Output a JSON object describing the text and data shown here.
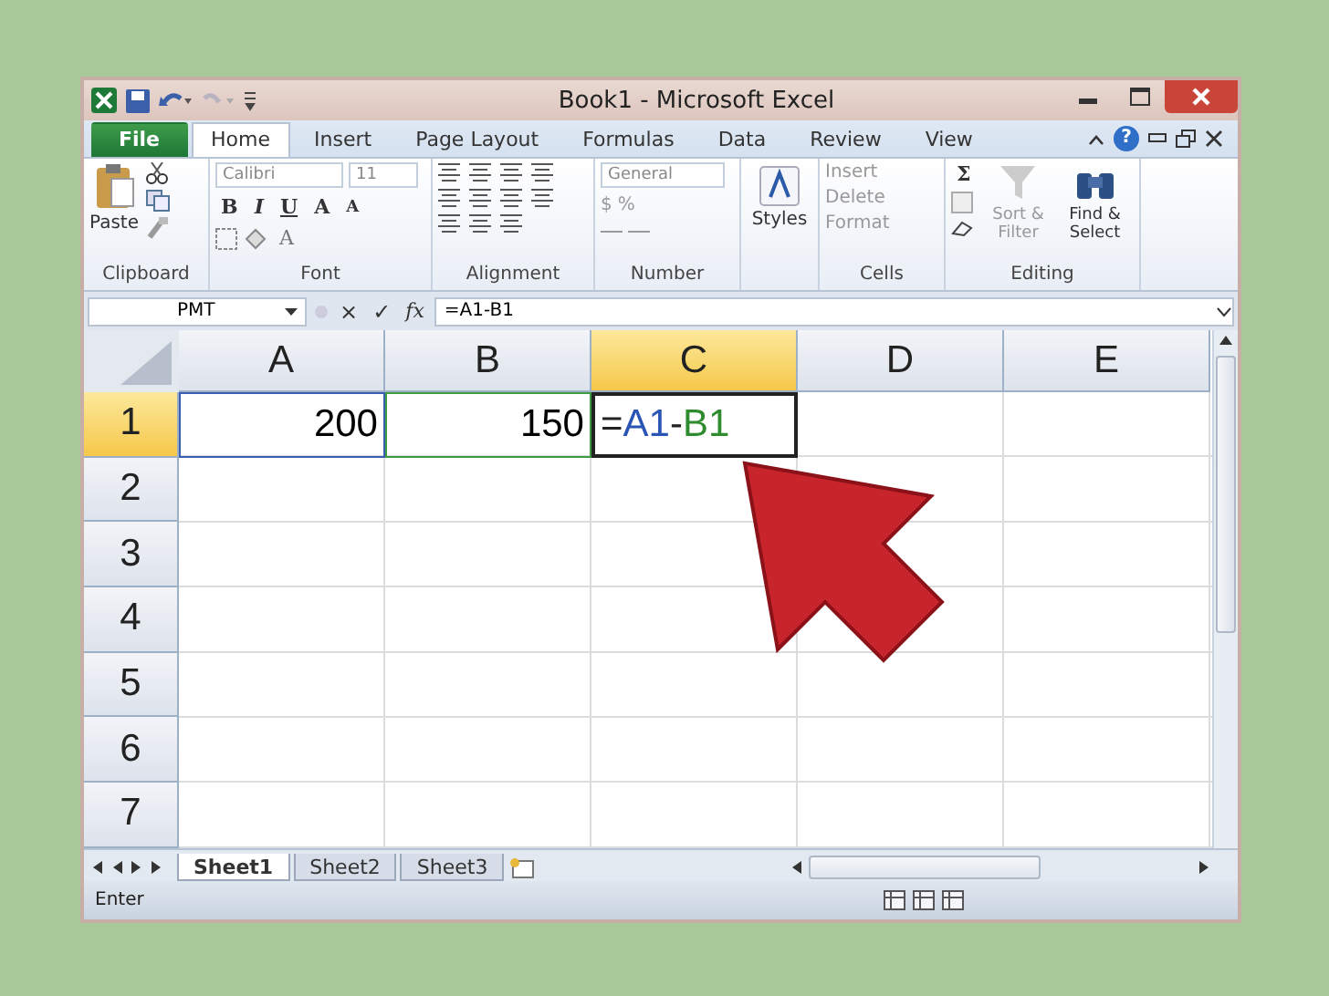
{
  "window": {
    "title": "Book1 - Microsoft Excel",
    "help": "?"
  },
  "ribbon_tabs": [
    {
      "label": "File",
      "kind": "file",
      "selected": false
    },
    {
      "label": "Home",
      "kind": "tab",
      "selected": true
    },
    {
      "label": "Insert",
      "kind": "tab",
      "selected": false
    },
    {
      "label": "Page Layout",
      "kind": "tab",
      "selected": false
    },
    {
      "label": "Formulas",
      "kind": "tab",
      "selected": false
    },
    {
      "label": "Data",
      "kind": "tab",
      "selected": false
    },
    {
      "label": "Review",
      "kind": "tab",
      "selected": false
    },
    {
      "label": "View",
      "kind": "tab",
      "selected": false
    }
  ],
  "ribbon": {
    "clipboard": {
      "paste": "Paste",
      "label": "Clipboard"
    },
    "font": {
      "name": "Calibri",
      "size": "11",
      "styles": [
        "B",
        "I",
        "U"
      ],
      "grow": "A",
      "shrink": "A",
      "font_color_button": "A",
      "label": "Font"
    },
    "alignment": {
      "label": "Alignment"
    },
    "number": {
      "format": "General",
      "currency": "$",
      "percent": "%",
      "label": "Number"
    },
    "styles": {
      "button": "Styles"
    },
    "cells": {
      "items": [
        "Insert",
        "Delete",
        "Format"
      ],
      "label": "Cells"
    },
    "editing": {
      "sum": "Σ",
      "sort": "Sort & Filter",
      "find": "Find & Select",
      "label": "Editing"
    }
  },
  "formula_bar": {
    "name_box": "PMT",
    "cancel": "×",
    "enter": "✓",
    "function": "fx",
    "formula": "=A1-B1"
  },
  "sheet": {
    "columns": [
      {
        "label": "A",
        "selected": false
      },
      {
        "label": "B",
        "selected": false
      },
      {
        "label": "C",
        "selected": true
      },
      {
        "label": "D",
        "selected": false
      },
      {
        "label": "E",
        "selected": false
      }
    ],
    "rows": [
      {
        "label": "1",
        "selected": true,
        "cells": [
          {
            "text": "200",
            "kind": "number",
            "color": "#3a5fb0",
            "selected": false
          },
          {
            "text": "150",
            "kind": "number",
            "color": "#3f9b3f",
            "selected": false
          },
          {
            "kind": "formula",
            "selected": true,
            "parts": [
              {
                "text": "=",
                "color": "#222222"
              },
              {
                "text": "A1",
                "color": "#2b55b5"
              },
              {
                "text": "-",
                "color": "#222222"
              },
              {
                "text": "B1",
                "color": "#2e8b2e"
              }
            ]
          }
        ]
      },
      {
        "label": "2",
        "selected": false,
        "cells": []
      },
      {
        "label": "3",
        "selected": false,
        "cells": []
      },
      {
        "label": "4",
        "selected": false,
        "cells": []
      },
      {
        "label": "5",
        "selected": false,
        "cells": []
      },
      {
        "label": "6",
        "selected": false,
        "cells": []
      },
      {
        "label": "7",
        "selected": false,
        "cells": []
      }
    ]
  },
  "sheet_tabs": [
    {
      "label": "Sheet1",
      "selected": true
    },
    {
      "label": "Sheet2",
      "selected": false
    },
    {
      "label": "Sheet3",
      "selected": false
    }
  ],
  "status_bar": {
    "mode": "Enter"
  }
}
